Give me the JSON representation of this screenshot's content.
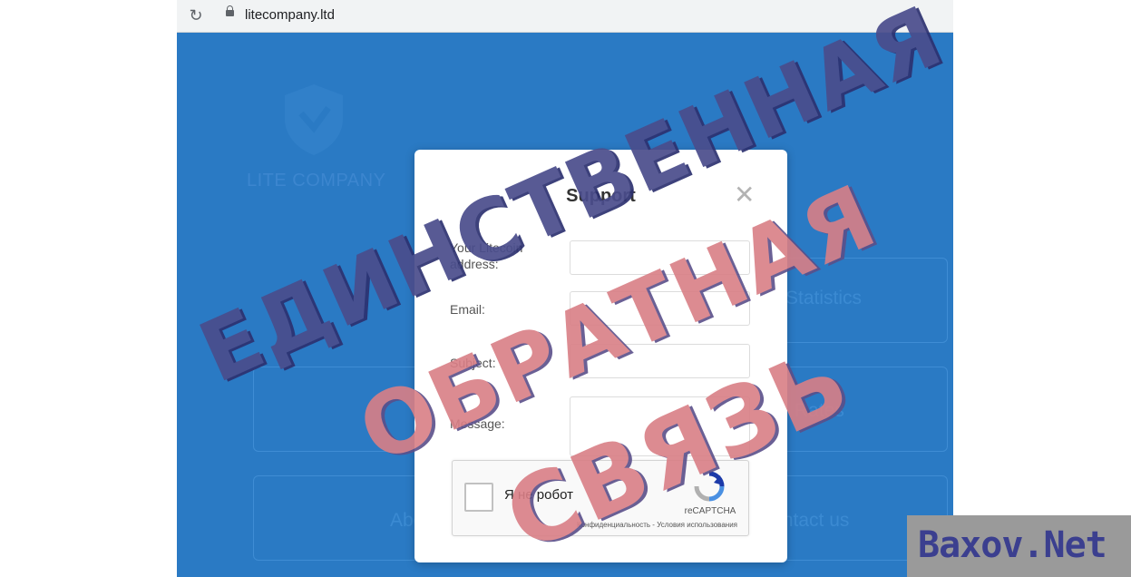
{
  "browser": {
    "url": "litecompany.ltd"
  },
  "site": {
    "logo_text": "LITE COMPANY",
    "cards": [
      "Statistics",
      "Rates",
      "About",
      "Contact us"
    ]
  },
  "modal": {
    "title": "Support",
    "close_glyph": "✕",
    "fields": {
      "address_label": "Your Litecoin address:",
      "email_label": "Email:",
      "subject_label": "Subject:",
      "message_label": "Message:"
    },
    "captcha": {
      "label": "Я не робот",
      "brand": "reCAPTCHA",
      "links": "Конфиденциальность - Условия использования"
    }
  },
  "stamp": {
    "line1": "ЕДИНСТВЕННАЯ",
    "line2": "ОБРАТНАЯ",
    "line3": "СВЯЗЬ",
    "color_dark": "#4a4d8c",
    "color_red": "#d97f86"
  },
  "watermark": {
    "text": "Baxov.Net"
  }
}
